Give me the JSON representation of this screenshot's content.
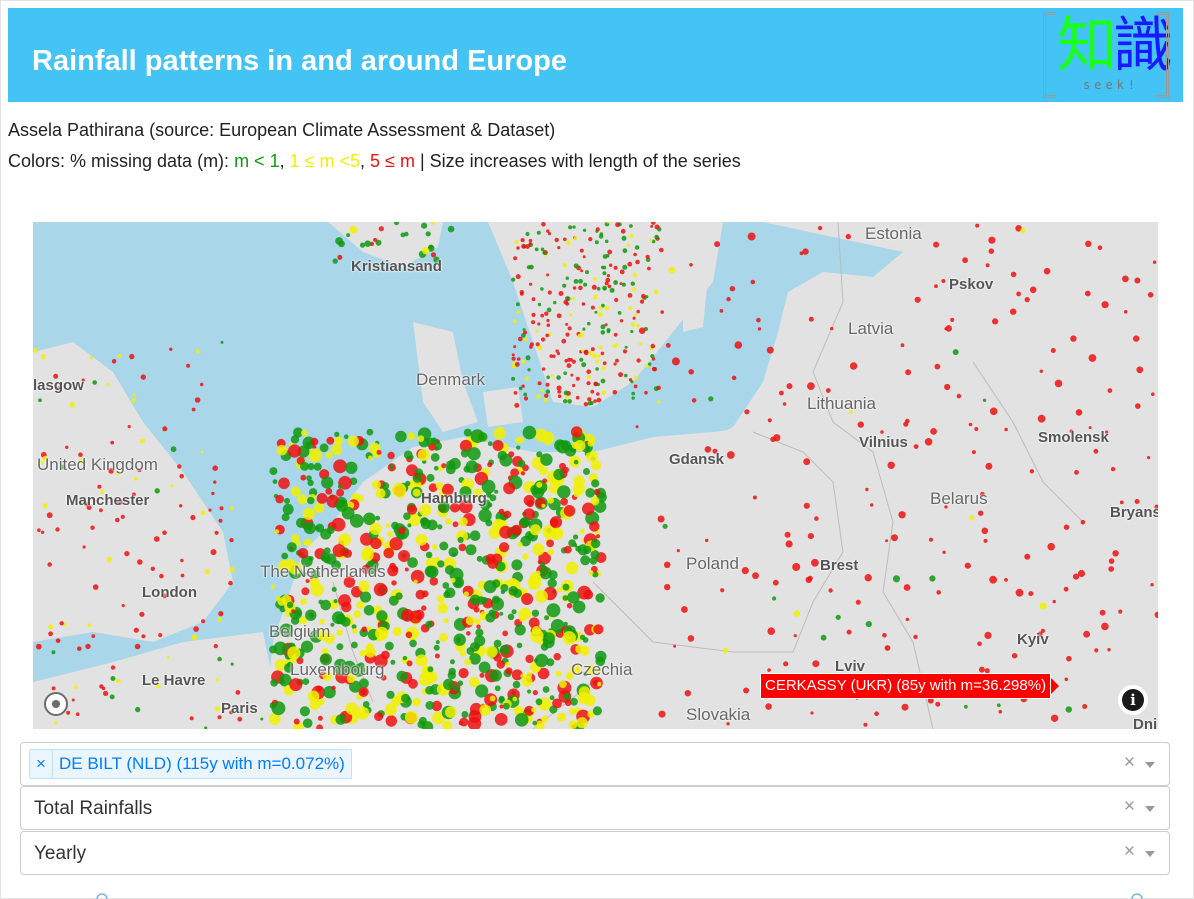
{
  "header": {
    "title": "Rainfall patterns in and around Europe",
    "logo_text": "知識",
    "logo_sub": "seek!"
  },
  "byline": "Assela Pathirana (source: European Climate Assessment & Dataset)",
  "legend": {
    "prefix": "Colors: % missing data (m): ",
    "green": "m < 1",
    "sep1": ", ",
    "yellow": "1 ≤ m <5",
    "sep2": ", ",
    "red": "5 ≤ m",
    "suffix": " | Size increases with length of the series",
    "colors": {
      "green": "#119911",
      "yellow": "#f0f000",
      "red": "#ee1111"
    }
  },
  "map": {
    "places": {
      "estonia": "Estonia",
      "kristiansand": "Kristiansand",
      "pskov": "Pskov",
      "latvia": "Latvia",
      "glasgow": "lasgow",
      "denmark": "Denmark",
      "lithuania": "Lithuania",
      "vilnius": "Vilnius",
      "smolensk": "Smolensk",
      "united_kingdom": "United Kingdom",
      "gdansk": "Gdansk",
      "manchester": "Manchester",
      "hamburg": "Hamburg",
      "belarus": "Belarus",
      "bryansk": "Bryans",
      "netherlands": "The Netherlands",
      "poland": "Poland",
      "brest": "Brest",
      "london": "London",
      "belgium": "Belgium",
      "kyiv": "Kyiv",
      "luxembourg": "Luxembourg",
      "czechia": "Czechia",
      "lviv": "Lviv",
      "le_havre": "Le Havre",
      "paris": "Paris",
      "slovakia": "Slovakia",
      "dnipro": "Dni"
    },
    "tooltip": "CERKASSY (UKR) (85y with m=36.298%)",
    "info_icon": "i"
  },
  "selects": {
    "station": {
      "chip_remove": "×",
      "chip": "DE BILT (NLD) (115y with m=0.072%)",
      "clear": "×"
    },
    "variable": {
      "value": "Total Rainfalls",
      "clear": "×"
    },
    "period": {
      "value": "Yearly",
      "clear": "×"
    }
  }
}
